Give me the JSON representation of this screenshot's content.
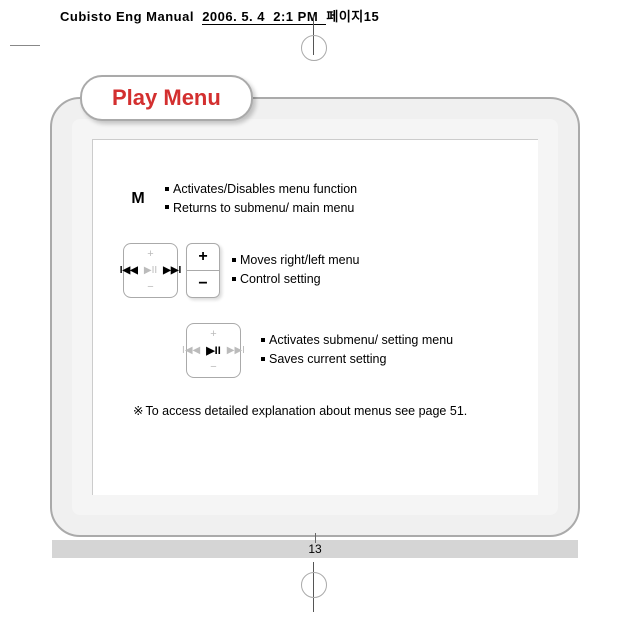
{
  "header": {
    "doc_name": "Cubisto Eng Manual",
    "date_part": "2006. 5. 4",
    "time_part": "2:1 PM",
    "page_ref": "페이지15"
  },
  "tab_title": "Play Menu",
  "sections": {
    "m_label": "M",
    "m_bullets": [
      "Activates/Disables menu function",
      "Returns to submenu/ main menu"
    ],
    "pm_plus": "+",
    "pm_minus": "−",
    "nav_bullets": [
      "Moves right/left menu",
      "Control setting"
    ],
    "center_bullets": [
      "Activates submenu/ setting menu",
      "Saves current setting"
    ],
    "note": "To access detailed explanation about menus see page 51."
  },
  "page_number": "13"
}
